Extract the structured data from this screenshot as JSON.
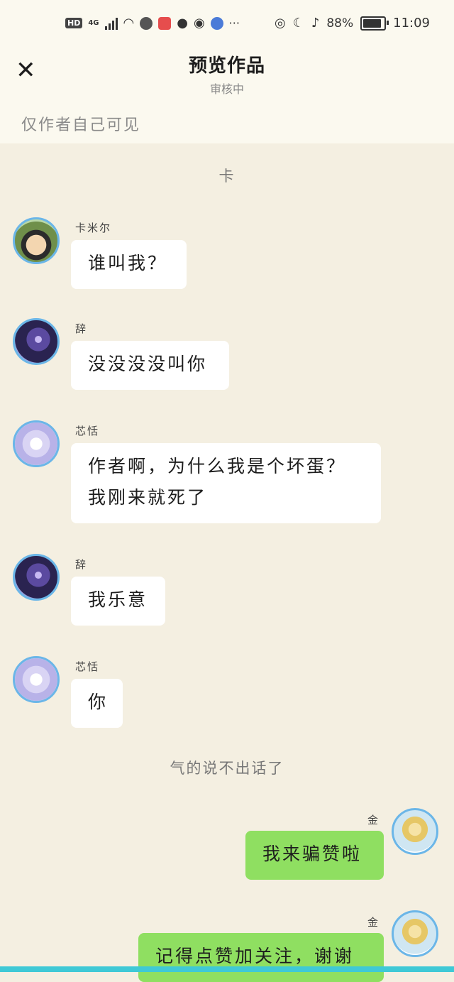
{
  "status_bar": {
    "left_badge": "HD",
    "network": "4G",
    "battery": "88%",
    "battery_level": 0.88,
    "time": "11:09",
    "more": "···"
  },
  "header": {
    "title": "预览作品",
    "subtitle": "审核中",
    "visibility_note": "仅作者自己可见"
  },
  "chat": {
    "note_top": "卡",
    "note_middle": "气的说不出话了",
    "messages": [
      {
        "sender": "卡米尔",
        "text": "谁叫我？"
      },
      {
        "sender": "辞",
        "text": "没没没没叫你"
      },
      {
        "sender": "芯恬",
        "text": "作者啊，为什么我是个坏蛋？我刚来就死了"
      },
      {
        "sender": "辞",
        "text": "我乐意"
      },
      {
        "sender": "芯恬",
        "text": "你"
      },
      {
        "sender": "金",
        "text": "我来骗赞啦"
      },
      {
        "sender": "金",
        "text": "记得点赞加关注，谢谢"
      }
    ]
  },
  "colors": {
    "background": "#f4efe1",
    "header_bg": "#fbf9ef",
    "bubble_white": "#ffffff",
    "bubble_green": "#8fdf61",
    "avatar_ring": "#6bb6e8"
  }
}
